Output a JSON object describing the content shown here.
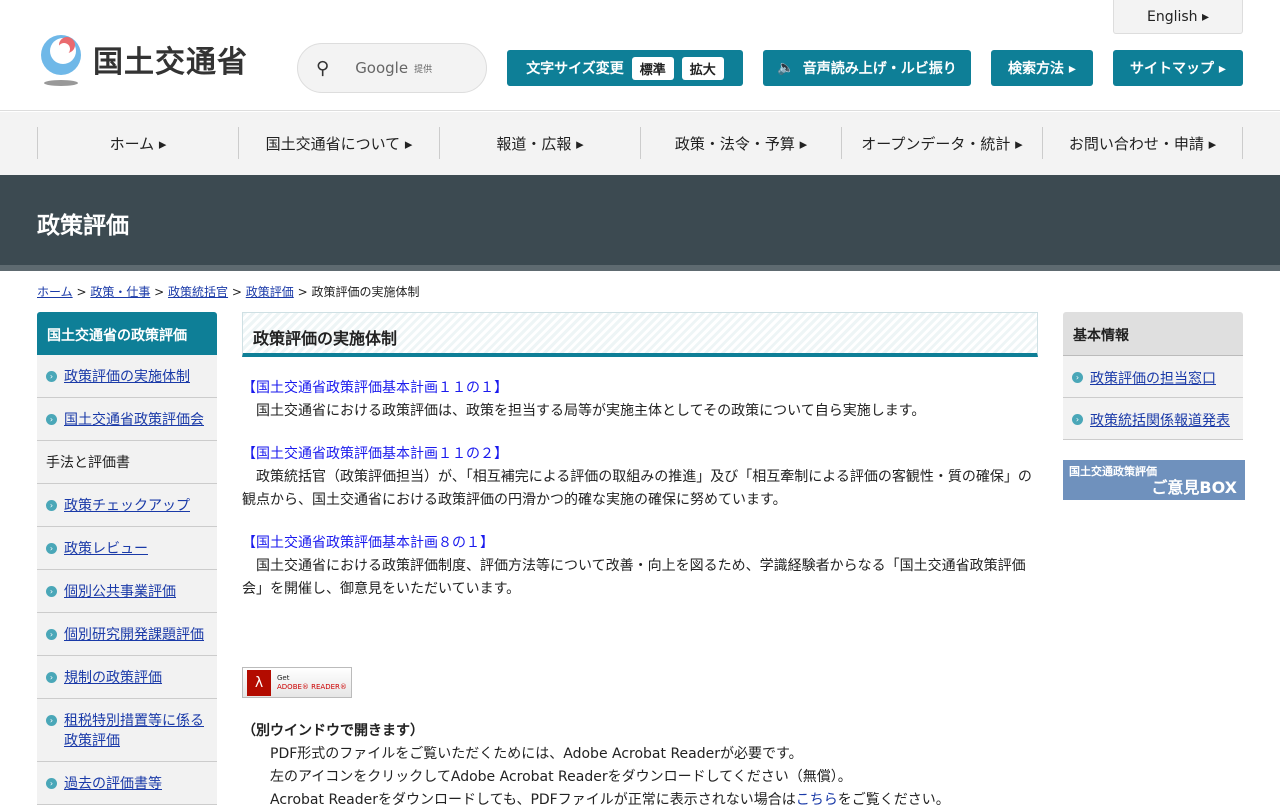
{
  "header": {
    "logo_text": "国土交通省",
    "search_label": "Google",
    "search_provider": "提供",
    "english": "English ▸",
    "font_size": "文字サイズ変更",
    "font_standard": "標準",
    "font_large": "拡大",
    "speech": "音声読み上げ・ルビ振り",
    "search_method": "検索方法 ▸",
    "sitemap": "サイトマップ ▸"
  },
  "nav": [
    "ホーム ▸",
    "国土交通省について ▸",
    "報道・広報 ▸",
    "政策・法令・予算 ▸",
    "オープンデータ・統計 ▸",
    "お問い合わせ・申請 ▸"
  ],
  "banner": "政策評価",
  "breadcrumb": {
    "items": [
      "ホーム",
      "政策・仕事",
      "政策統括官",
      "政策評価"
    ],
    "sep": " > ",
    "current": "政策評価の実施体制"
  },
  "left": {
    "title": "国土交通省の政策評価",
    "items": [
      {
        "label": "政策評価の実施体制",
        "link": true
      },
      {
        "label": "国土交通省政策評価会",
        "link": true
      },
      {
        "label": "手法と評価書",
        "link": false
      },
      {
        "label": "政策チェックアップ",
        "link": true
      },
      {
        "label": "政策レビュー",
        "link": true
      },
      {
        "label": "個別公共事業評価",
        "link": true
      },
      {
        "label": "個別研究開発課題評価",
        "link": true
      },
      {
        "label": "規制の政策評価",
        "link": true
      },
      {
        "label": "租税特別措置等に係る政策評価",
        "link": true
      },
      {
        "label": "過去の評価書等",
        "link": true
      }
    ]
  },
  "main": {
    "title": "政策評価の実施体制",
    "sections": [
      {
        "link": "【国土交通省政策評価基本計画１１の１】",
        "text": "国土交通省における政策評価は、政策を担当する局等が実施主体としてその政策について自ら実施します。"
      },
      {
        "link": "【国土交通省政策評価基本計画１１の２】",
        "text": "政策統括官（政策評価担当）が、「相互補完による評価の取組みの推進」及び「相互牽制による評価の客観性・質の確保」の観点から、国土交通省における政策評価の円滑かつ的確な実施の確保に努めています。"
      },
      {
        "link": "【国土交通省政策評価基本計画８の１】",
        "text": "国土交通省における政策評価制度、評価方法等について改善・向上を図るため、学識経験者からなる「国土交通省政策評価会」を開催し、御意見をいただいています。"
      }
    ],
    "adobe": {
      "get": "Get",
      "name": "ADOBE® READER®"
    },
    "pdf_note": {
      "heading": "（別ウインドウで開きます）",
      "lines": [
        "PDF形式のファイルをご覧いただくためには、Adobe Acrobat Readerが必要です。",
        "左のアイコンをクリックしてAdobe Acrobat Readerをダウンロードしてください（無償）。"
      ],
      "line3_pre": "Acrobat Readerをダウンロードしても、PDFファイルが正常に表示されない場合は",
      "line3_link": "こちら",
      "line3_post": "をご覧ください。"
    }
  },
  "right": {
    "title": "基本情報",
    "items": [
      "政策評価の担当窓口",
      "政策統括関係報道発表"
    ],
    "box_small": "国土交通政策評価",
    "box_large": "ご意見BOX"
  }
}
